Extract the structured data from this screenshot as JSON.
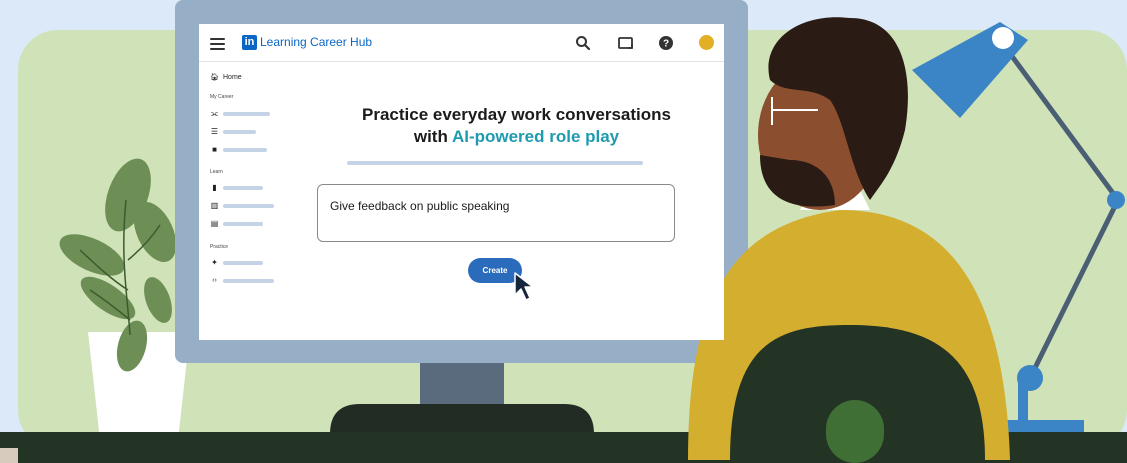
{
  "header": {
    "brand_logo": "in",
    "brand_name": "Learning Career Hub"
  },
  "topbar_icons": [
    "search-icon",
    "screen-share-icon",
    "help-icon",
    "avatar"
  ],
  "sidebar": {
    "home_label": "Home",
    "sections": [
      {
        "label": "My Career",
        "items": [
          "network-icon",
          "checklist-icon",
          "briefcase-icon"
        ]
      },
      {
        "label": "Learn",
        "items": [
          "document-icon",
          "book-icon",
          "card-icon"
        ]
      },
      {
        "label": "Practice",
        "items": [
          "sparkle-icon",
          "code-icon"
        ]
      }
    ]
  },
  "main": {
    "title_line1": "Practice everyday work conversations",
    "title_line2_prefix": "with ",
    "title_line2_accent": "AI-powered role play",
    "prompt_value": "Give feedback on public speaking",
    "create_label": "Create"
  },
  "colors": {
    "brand": "#0a66c2",
    "accent": "#1f9bb0",
    "button": "#2a6cbb",
    "avatar": "#e3b025"
  }
}
